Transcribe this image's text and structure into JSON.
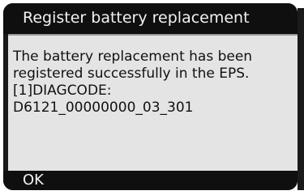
{
  "dialog": {
    "title": "Register battery replacement",
    "message_lines": [
      "The battery replacement has been",
      "registered successfully in the EPS.",
      "[1]DIAGCODE:",
      "D6121_00000000_03_301"
    ],
    "ok_label": "OK"
  },
  "colors": {
    "title_bar": "#0f0f0f",
    "panel_background": "#e4e4e4",
    "text_light": "#f2f2f2",
    "text_dark": "#111111"
  }
}
